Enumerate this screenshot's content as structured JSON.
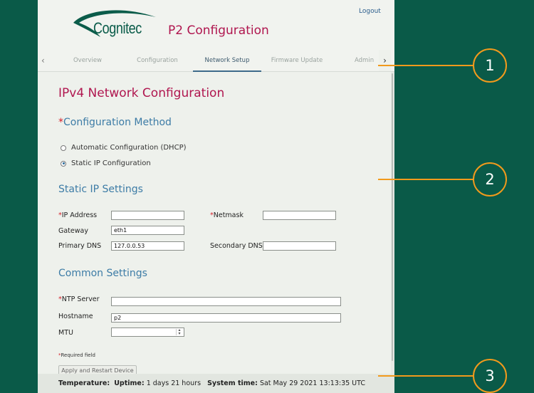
{
  "header": {
    "logo_text": "Cognitec",
    "app_title": "P2 Configuration",
    "logout_label": "Logout"
  },
  "tabs": [
    {
      "label": "Overview"
    },
    {
      "label": "Configuration"
    },
    {
      "label": "Network Setup"
    },
    {
      "label": "Firmware Update"
    },
    {
      "label": "Admin"
    }
  ],
  "active_tab": "Network Setup",
  "main": {
    "page_title": "IPv4 Network Configuration",
    "config_method": {
      "required_mark": "*",
      "heading": "Configuration Method",
      "options": [
        {
          "label": "Automatic Configuration (DHCP)",
          "selected": false
        },
        {
          "label": "Static IP Configuration",
          "selected": true
        }
      ]
    },
    "static_ip": {
      "heading": "Static IP Settings",
      "ip_address": {
        "required_mark": "*",
        "label": "IP Address",
        "value": ""
      },
      "netmask": {
        "required_mark": "*",
        "label": "Netmask",
        "value": ""
      },
      "gateway": {
        "label": "Gateway",
        "value": "eth1"
      },
      "primary_dns": {
        "label": "Primary DNS",
        "value": "127.0.0.53"
      },
      "secondary_dns": {
        "label": "Secondary DNS",
        "value": ""
      }
    },
    "common": {
      "heading": "Common Settings",
      "ntp_server": {
        "required_mark": "*",
        "label": "NTP Server",
        "value": ""
      },
      "hostname": {
        "label": "Hostname",
        "value": "p2"
      },
      "mtu": {
        "label": "MTU",
        "value": ""
      }
    },
    "required_note": {
      "mark": "*",
      "text": "Required field"
    },
    "apply_button": "Apply and Restart Device"
  },
  "status": {
    "temperature_label": "Temperature:",
    "temperature_value": "",
    "uptime_label": "Uptime:",
    "uptime_value": "1 days 21 hours",
    "system_time_label": "System time:",
    "system_time_value": "Sat May 29 2021 13:13:35 UTC"
  },
  "callouts": [
    {
      "number": "1"
    },
    {
      "number": "2"
    },
    {
      "number": "3"
    }
  ],
  "colors": {
    "background": "#0a5a48",
    "accent_magenta": "#b0164f",
    "section_blue": "#3d7ca6",
    "callout_orange": "#f29a1c"
  }
}
